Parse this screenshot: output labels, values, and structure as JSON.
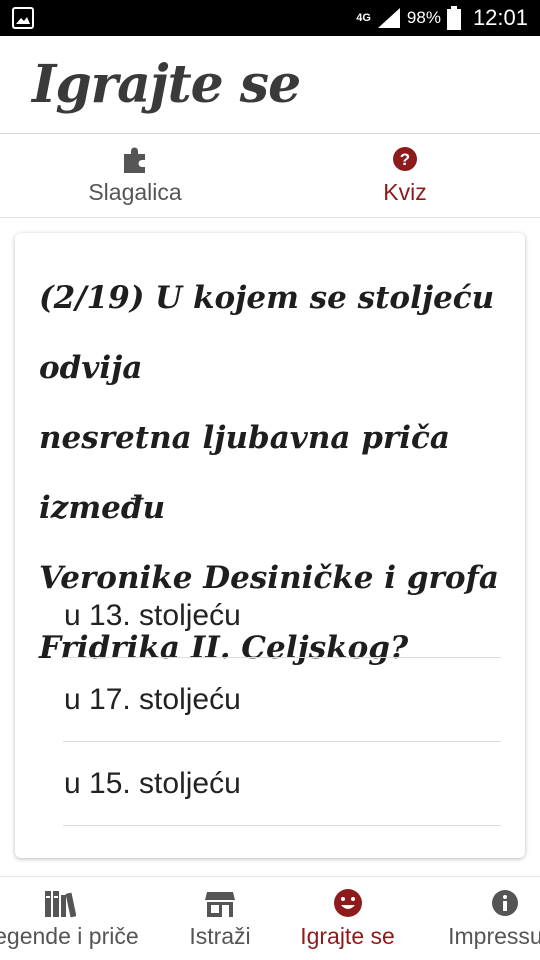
{
  "status_bar": {
    "network": "4G",
    "battery": "98%",
    "time": "12:01"
  },
  "header": {
    "title": "Igrajte se"
  },
  "tabs": [
    {
      "label": "Slagalica",
      "icon": "puzzle-icon"
    },
    {
      "label": "Kviz",
      "icon": "question-circle-icon"
    }
  ],
  "quiz": {
    "question_lines": [
      "(2/19) U kojem se stoljeću odvija",
      "nesretna ljubavna priča između",
      "Veronike Desiničke i grofa",
      "Fridrika II. Celjskog?"
    ],
    "answers": [
      "u 13. stoljeću",
      "u 17. stoljeću",
      "u 15. stoljeću"
    ]
  },
  "bottom_nav": [
    {
      "label": "Legende i priče",
      "icon": "books-icon"
    },
    {
      "label": "Istraži",
      "icon": "store-icon"
    },
    {
      "label": "Igrajte se",
      "icon": "smile-icon"
    },
    {
      "label": "Impressum",
      "icon": "info-icon"
    }
  ],
  "colors": {
    "accent": "#8e1b1b",
    "muted": "#555555"
  }
}
